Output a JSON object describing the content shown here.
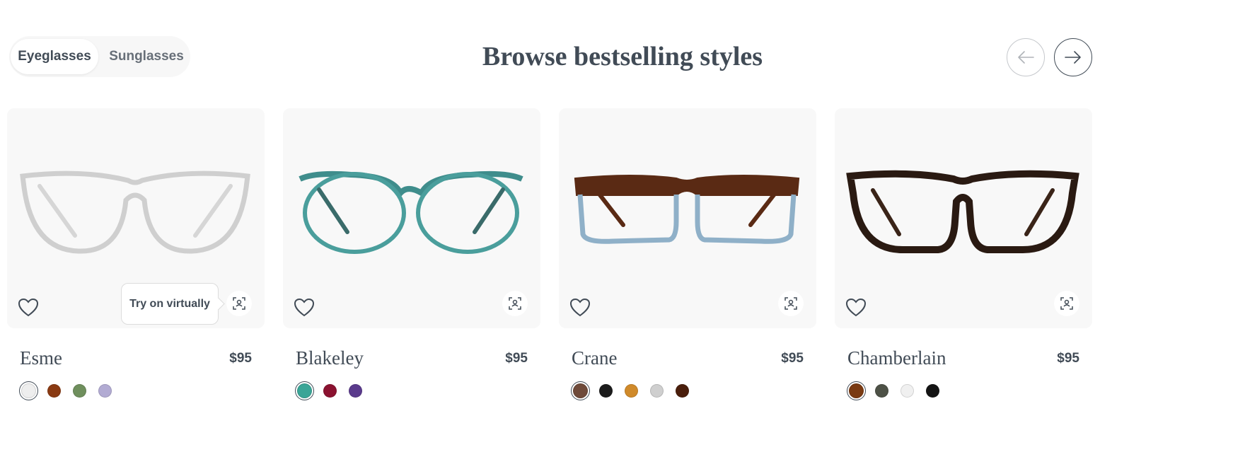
{
  "toggle": {
    "options": [
      "Eyeglasses",
      "Sunglasses"
    ],
    "selected": "Eyeglasses"
  },
  "heading": "Browse bestselling styles",
  "nav": {
    "prev_icon": "arrow-left-icon",
    "next_icon": "arrow-right-icon"
  },
  "tooltip": "Try on virtually",
  "products": [
    {
      "name": "Esme",
      "price": "$95",
      "frame_color": "#dcdcdc",
      "swatches": [
        {
          "color": "#eeeeee",
          "selected": true
        },
        {
          "color": "#8a3a12",
          "selected": false
        },
        {
          "color": "#6f8f5d",
          "selected": false
        },
        {
          "color": "#b2abd3",
          "selected": false
        }
      ]
    },
    {
      "name": "Blakeley",
      "price": "$95",
      "frame_color": "#3f8d8c",
      "swatches": [
        {
          "color": "#3aa597",
          "selected": true
        },
        {
          "color": "#8b1230",
          "selected": false
        },
        {
          "color": "#5a3a8c",
          "selected": false
        }
      ]
    },
    {
      "name": "Crane",
      "price": "$95",
      "frame_color": "#5a2a14",
      "swatches": [
        {
          "color": "#6f4a3a",
          "selected": true
        },
        {
          "color": "#1c1c1c",
          "selected": false
        },
        {
          "color": "#d08a2a",
          "selected": false
        },
        {
          "color": "#cfcfcf",
          "selected": false
        },
        {
          "color": "#4a1e0c",
          "selected": false
        }
      ]
    },
    {
      "name": "Chamberlain",
      "price": "$95",
      "frame_color": "#2a1a12",
      "swatches": [
        {
          "color": "#7a3a12",
          "selected": true
        },
        {
          "color": "#4d5146",
          "selected": false
        },
        {
          "color": "#f0f0f0",
          "selected": false
        },
        {
          "color": "#141414",
          "selected": false
        }
      ]
    }
  ]
}
